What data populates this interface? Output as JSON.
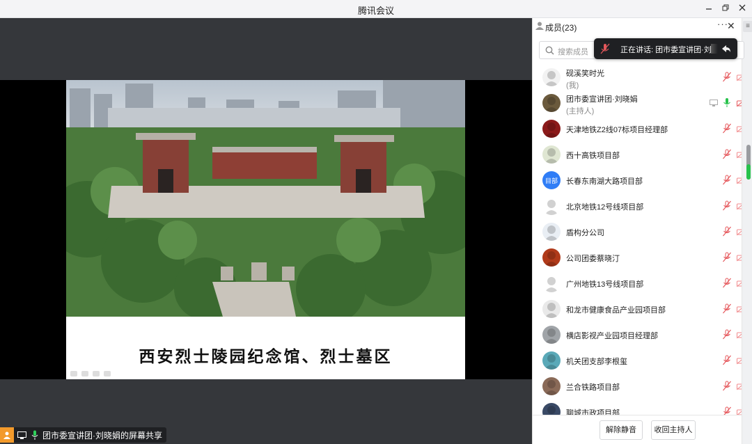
{
  "window": {
    "title": "腾讯会议",
    "controls": [
      "minimize",
      "restore",
      "close"
    ]
  },
  "slide": {
    "caption": "西安烈士陵园纪念馆、烈士墓区"
  },
  "share_tag": {
    "text": "团市委宣讲团·刘晓娟的屏幕共享"
  },
  "panel": {
    "title": "成员(23)",
    "more": "···",
    "close": "✕",
    "menu": "≡",
    "search_placeholder": "搜索成员",
    "speaking_text": "正在讲话: 团市委宣讲团·刘..."
  },
  "members": [
    {
      "name": "砚溪笑时光",
      "sub": "(我)",
      "avatar_color": "#f2f2f2",
      "mic": "muted",
      "screen": false
    },
    {
      "name": "团市委宣讲团·刘晓娟",
      "sub": "(主持人)",
      "avatar_color": "#6b5a3d",
      "mic": "on",
      "screen": true
    },
    {
      "name": "天津地铁Z2线07标项目经理部",
      "sub": "",
      "avatar_color": "#8b1a1a",
      "mic": "muted",
      "screen": false
    },
    {
      "name": "西十高铁项目部",
      "sub": "",
      "avatar_color": "#dfe6d2",
      "mic": "muted",
      "screen": false
    },
    {
      "name": "长春东南湖大路项目部",
      "sub": "",
      "avatar_color": "#2f7df6",
      "avatar_text": "目部",
      "mic": "muted",
      "screen": false
    },
    {
      "name": "北京地铁12号线项目部",
      "sub": "",
      "avatar_color": "#ffffff",
      "mic": "muted",
      "screen": false
    },
    {
      "name": "盾构分公司",
      "sub": "",
      "avatar_color": "#e9eef4",
      "mic": "muted",
      "screen": false
    },
    {
      "name": "公司团委蔡晓汀",
      "sub": "",
      "avatar_color": "#b03a1a",
      "mic": "muted",
      "screen": false
    },
    {
      "name": "广州地铁13号线项目部",
      "sub": "",
      "avatar_color": "#ffffff",
      "mic": "muted",
      "screen": false
    },
    {
      "name": "和龙市健康食品产业园项目部",
      "sub": "",
      "avatar_color": "#e9e9e9",
      "mic": "muted",
      "screen": false
    },
    {
      "name": "横店影视产业园项目经理部",
      "sub": "",
      "avatar_color": "#a0a4a8",
      "mic": "muted",
      "screen": false
    },
    {
      "name": "机关团支部李根玺",
      "sub": "",
      "avatar_color": "#5aa9b8",
      "mic": "muted",
      "screen": false
    },
    {
      "name": "兰合铁路项目部",
      "sub": "",
      "avatar_color": "#8a6a58",
      "mic": "muted",
      "screen": false
    },
    {
      "name": "聊城市政项目部",
      "sub": "",
      "avatar_color": "#3a4a66",
      "mic": "muted",
      "screen": false
    }
  ],
  "footer": {
    "unmute_all": "解除静音",
    "reclaim_host": "收回主持人"
  },
  "colors": {
    "accent": "#f39a2b",
    "muted_red": "#e5575b",
    "mic_green": "#27c24c",
    "stage_bg": "#35373b"
  }
}
